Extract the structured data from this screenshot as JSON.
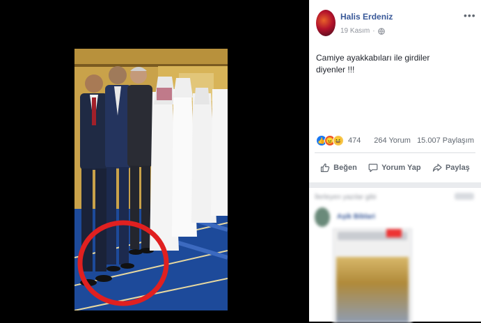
{
  "post": {
    "author": "Halis Erdeniz",
    "date": "19 Kasım",
    "privacy_icon": "globe-icon",
    "text_line1": "Camiye ayakkabıları ile girdiler",
    "text_line2": "diyenler !!!",
    "reactions": {
      "icons": [
        "like-icon",
        "angry-icon",
        "haha-icon"
      ],
      "count": "474"
    },
    "comments": "264 Yorum",
    "shares": "15.007 Paylaşım",
    "actions": {
      "like": "Beğen",
      "comment": "Yorum Yap",
      "share": "Paylaş"
    }
  },
  "suggested": {
    "title": "İlerleyen yazılar gibi",
    "name": "Aşik Biblari"
  },
  "colors": {
    "link_blue": "#385898",
    "like_blue": "#1877f2",
    "circle_red": "#e02020"
  }
}
